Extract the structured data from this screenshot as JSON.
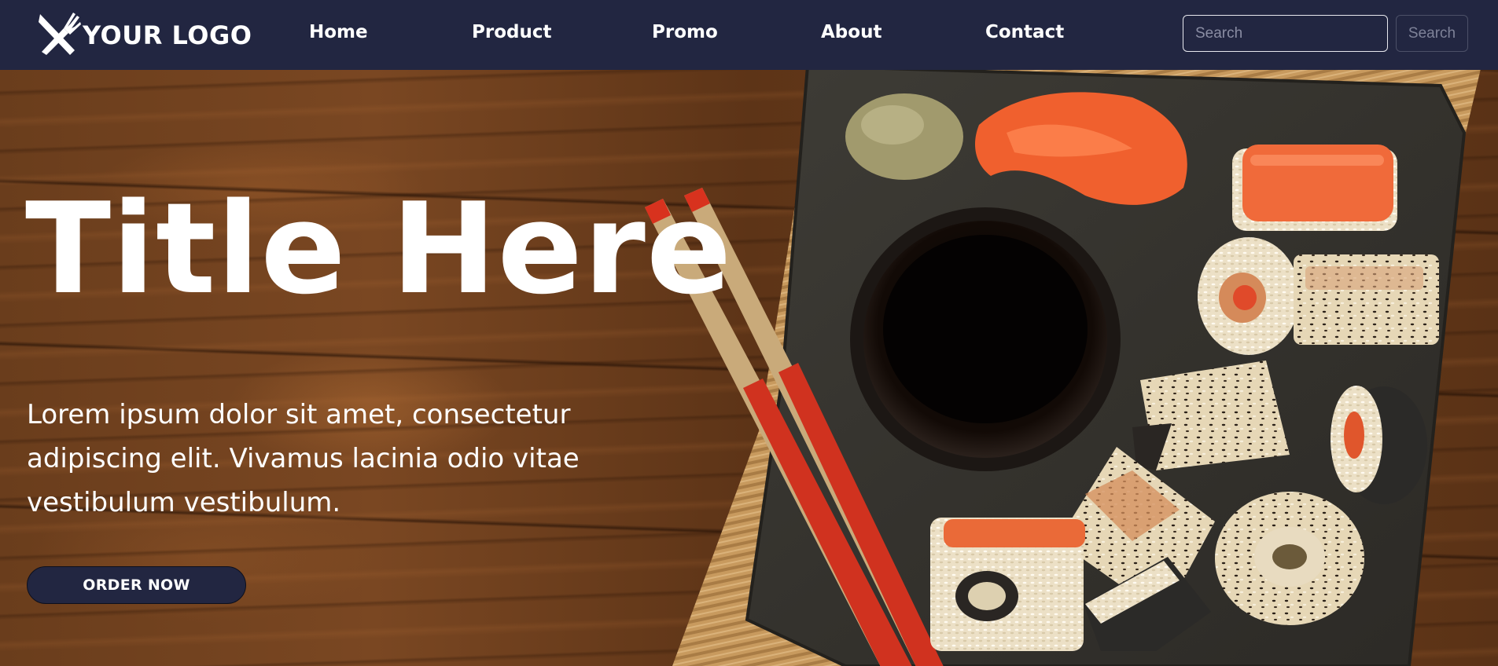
{
  "brand": {
    "logo_text": "YOUR LOGO",
    "logo_icon": "fork-knife-icon"
  },
  "nav": {
    "items": [
      {
        "label": "Home"
      },
      {
        "label": "Product"
      },
      {
        "label": "Promo"
      },
      {
        "label": "About"
      },
      {
        "label": "Contact"
      }
    ]
  },
  "search": {
    "placeholder": "Search",
    "button_label": "Search"
  },
  "hero": {
    "title": "Title Here",
    "text": "Lorem ipsum dolor sit amet, consectetur adipiscing elit. Vivamus lacinia odio vitae vestibulum vestibulum.",
    "cta_label": "ORDER NOW",
    "image": "sushi-on-slate-with-chopsticks"
  },
  "colors": {
    "navbar": "#222641",
    "button": "#222641",
    "text": "#ffffff",
    "chopsticks": "#d8321e",
    "salmon": "#f06a3a"
  }
}
